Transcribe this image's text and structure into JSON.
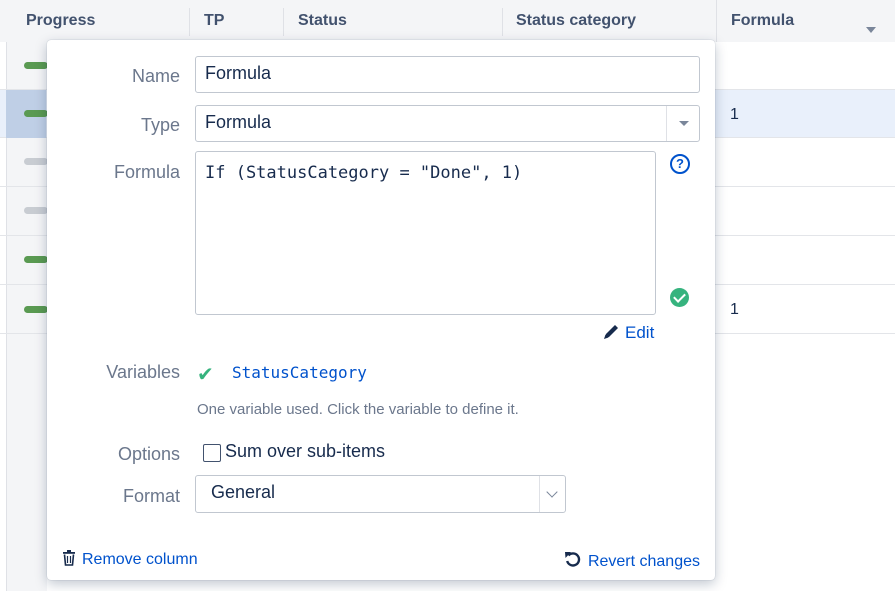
{
  "grid": {
    "columns": [
      "Progress",
      "TP",
      "Status",
      "Status category",
      "Formula"
    ],
    "rows": [
      {
        "progress": "green",
        "formula": ""
      },
      {
        "progress": "green",
        "formula": "1",
        "selected": true
      },
      {
        "progress": "grey",
        "formula": ""
      },
      {
        "progress": "grey",
        "formula": ""
      },
      {
        "progress": "green",
        "formula": ""
      },
      {
        "progress": "green",
        "formula": "1"
      }
    ]
  },
  "dialog": {
    "name_label": "Name",
    "name_value": "Formula",
    "type_label": "Type",
    "type_value": "Formula",
    "formula_label": "Formula",
    "formula_value": "If (StatusCategory = \"Done\", 1)",
    "help_glyph": "?",
    "edit_label": "Edit",
    "variables_label": "Variables",
    "variable_name": "StatusCategory",
    "variables_hint": "One variable used. Click the variable to define it.",
    "options_label": "Options",
    "sum_over_label": "Sum over sub-items",
    "sum_over_checked": false,
    "format_label": "Format",
    "format_value": "General",
    "remove_label": "Remove column",
    "revert_label": "Revert changes"
  },
  "colors": {
    "accent": "#0052cc",
    "success": "#36b37e",
    "progress_green": "#5a9a52",
    "progress_grey": "#c8ccd2"
  },
  "icons": [
    "sort-desc-icon",
    "help-icon",
    "check-circle-icon",
    "pencil-icon",
    "checkmark-icon",
    "trash-icon",
    "revert-icon",
    "dropdown-caret-icon",
    "dropdown-chevron-icon"
  ]
}
